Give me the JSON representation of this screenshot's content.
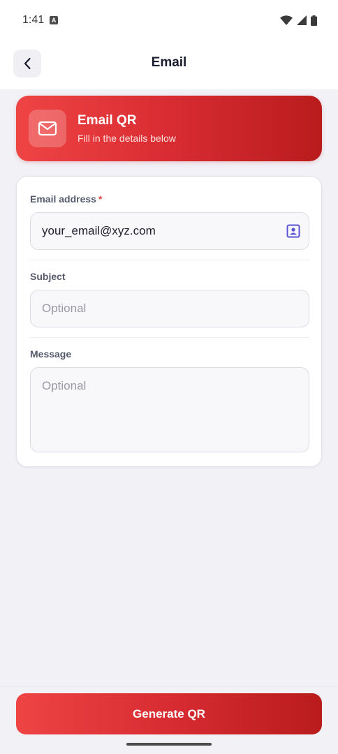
{
  "status_bar": {
    "time": "1:41",
    "badge": "A"
  },
  "app_bar": {
    "title": "Email"
  },
  "header": {
    "title": "Email QR",
    "subtitle": "Fill in the details below"
  },
  "form": {
    "email": {
      "label": "Email address",
      "required_mark": "*",
      "value": "your_email@xyz.com"
    },
    "subject": {
      "label": "Subject",
      "placeholder": "Optional"
    },
    "message": {
      "label": "Message",
      "placeholder": "Optional"
    }
  },
  "actions": {
    "generate_label": "Generate QR"
  },
  "colors": {
    "accent_start": "#ef4444",
    "accent_end": "#b91c1c",
    "contact_icon": "#5b55d6"
  }
}
